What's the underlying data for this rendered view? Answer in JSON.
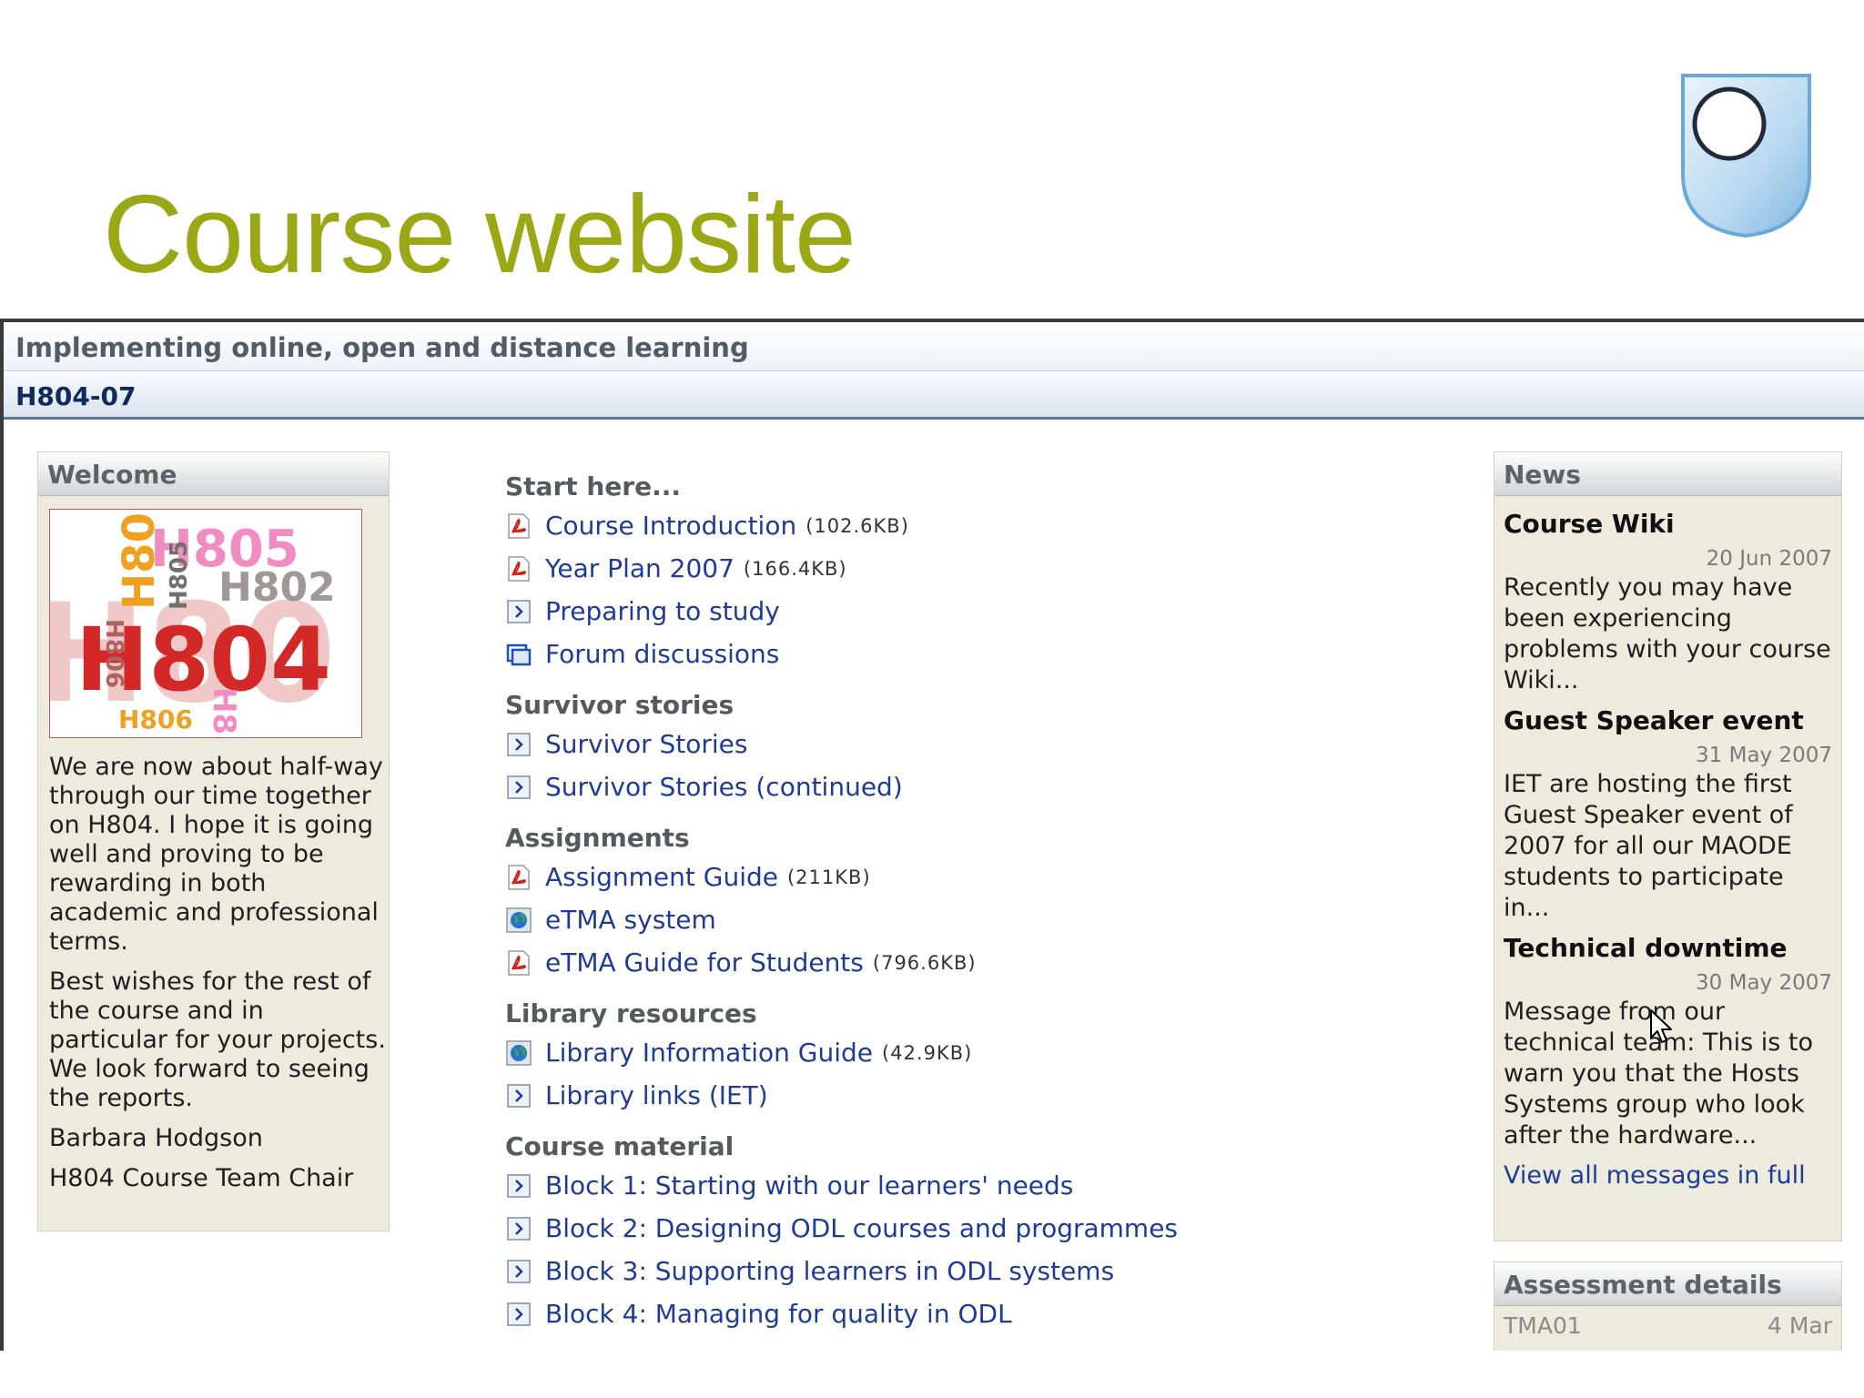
{
  "slide": {
    "title": "Course website"
  },
  "header": {
    "site_title": "Implementing online, open and distance learning",
    "course_code": "H804-07"
  },
  "welcome": {
    "heading": "Welcome",
    "image_words": [
      "H805",
      "H802",
      "H804",
      "H806",
      "H80",
      "H806",
      "H805",
      "H85",
      "H80"
    ],
    "paragraphs": [
      "We are now about half-way through our time together on H804. I hope it is going well and proving to be rewarding in both academic and professional terms.",
      "Best wishes for the rest of the course and in particular for your projects. We look forward to seeing the reports.",
      "Barbara Hodgson",
      "H804 Course Team Chair"
    ]
  },
  "sections": [
    {
      "title": "Start here...",
      "items": [
        {
          "label": "Course Introduction",
          "size": "(102.6KB)",
          "icon": "pdf-icon"
        },
        {
          "label": "Year Plan 2007",
          "size": "(166.4KB)",
          "icon": "pdf-icon"
        },
        {
          "label": "Preparing to study",
          "size": "",
          "icon": "page-arrow-icon"
        },
        {
          "label": "Forum discussions",
          "size": "",
          "icon": "forum-icon"
        }
      ]
    },
    {
      "title": "Survivor stories",
      "items": [
        {
          "label": "Survivor Stories",
          "size": "",
          "icon": "page-arrow-icon"
        },
        {
          "label": "Survivor Stories (continued)",
          "size": "",
          "icon": "page-arrow-icon"
        }
      ]
    },
    {
      "title": "Assignments",
      "items": [
        {
          "label": "Assignment Guide",
          "size": "(211KB)",
          "icon": "pdf-icon"
        },
        {
          "label": "eTMA system",
          "size": "",
          "icon": "globe-icon"
        },
        {
          "label": "eTMA Guide for Students",
          "size": "(796.6KB)",
          "icon": "pdf-icon"
        }
      ]
    },
    {
      "title": "Library resources",
      "items": [
        {
          "label": "Library Information Guide",
          "size": "(42.9KB)",
          "icon": "globe-icon"
        },
        {
          "label": "Library links (IET)",
          "size": "",
          "icon": "page-arrow-icon"
        }
      ]
    },
    {
      "title": "Course material",
      "items": [
        {
          "label": "Block 1: Starting with our learners' needs",
          "size": "",
          "icon": "page-arrow-icon"
        },
        {
          "label": "Block 2: Designing ODL courses and programmes",
          "size": "",
          "icon": "page-arrow-icon"
        },
        {
          "label": "Block 3: Supporting learners in ODL systems",
          "size": "",
          "icon": "page-arrow-icon"
        },
        {
          "label": "Block 4: Managing for quality in ODL",
          "size": "",
          "icon": "page-arrow-icon"
        }
      ]
    }
  ],
  "news": {
    "heading": "News",
    "items": [
      {
        "title": "Course Wiki",
        "date": "20 Jun 2007",
        "excerpt": "Recently you may have been experiencing problems with your course Wiki..."
      },
      {
        "title": "Guest Speaker event",
        "date": "31 May 2007",
        "excerpt": "IET are hosting the first Guest Speaker event of 2007 for all our MAODE students to participate in..."
      },
      {
        "title": "Technical downtime",
        "date": "30 May 2007",
        "excerpt": "Message from our technical team: This is to warn you that the Hosts Systems group who look after the hardware..."
      }
    ],
    "view_all": "View all messages in full"
  },
  "assessment": {
    "heading": "Assessment details",
    "rows": [
      {
        "name": "TMA01",
        "date": "4 Mar"
      }
    ]
  },
  "colors": {
    "title_green": "#99a814",
    "link_blue": "#1e3b95",
    "box_bg": "#ecebdd"
  }
}
